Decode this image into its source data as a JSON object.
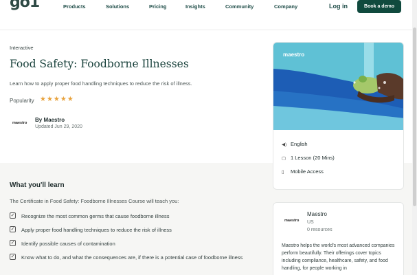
{
  "nav": {
    "logo": "go1",
    "links": [
      "Products",
      "Solutions",
      "Pricing",
      "Insights",
      "Community",
      "Company"
    ],
    "login": "Log in",
    "cta": "Book a demo"
  },
  "course": {
    "type": "Interactive",
    "title": "Food Safety: Foodborne Illnesses",
    "description": "Learn how to apply proper food handling techniques to reduce the risk of illness.",
    "popularity_label": "Popularity",
    "rating": 5,
    "stars": "★★★★★",
    "provider_logo": "maestro",
    "by": "By Maestro",
    "updated": "Updated Jun 29, 2020"
  },
  "learn": {
    "title": "What you'll learn",
    "intro": "The Certificate in Food Safety: Foodborne Illnesses Course will teach you:",
    "items": [
      "Recognize the most common germs that cause foodborne illness",
      "Apply proper food handling techniques to reduce the risk of illness",
      "Identify possible causes of contamination",
      "Know what to do, and what the consequences are, if there is a potential case of foodborne illness"
    ]
  },
  "card": {
    "image_brand": "maestro",
    "language": "English",
    "lessons": "1 Lesson (20 Mins)",
    "access": "Mobile Access"
  },
  "provider": {
    "logo": "maestro",
    "name": "Maestro",
    "country": "US",
    "resources": "0 resources",
    "about": "Maestro helps the world's most advanced companies perform beautifully. Their offerings cover topics including compliance, healthcare, safety, and food handling, for people working in"
  },
  "colors": {
    "brand": "#104a3e",
    "star": "#e8a23c",
    "card_sky": "#5fc1d5",
    "card_wave": "#1d5db5"
  }
}
